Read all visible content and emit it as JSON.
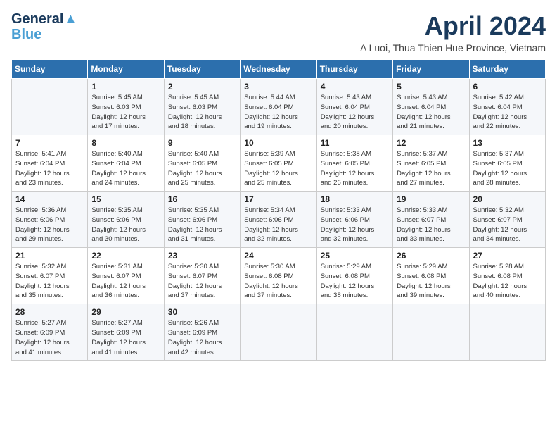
{
  "header": {
    "logo_line1": "General",
    "logo_line2": "Blue",
    "month": "April 2024",
    "location": "A Luoi, Thua Thien Hue Province, Vietnam"
  },
  "weekdays": [
    "Sunday",
    "Monday",
    "Tuesday",
    "Wednesday",
    "Thursday",
    "Friday",
    "Saturday"
  ],
  "weeks": [
    [
      {
        "day": "",
        "info": ""
      },
      {
        "day": "1",
        "info": "Sunrise: 5:45 AM\nSunset: 6:03 PM\nDaylight: 12 hours\nand 17 minutes."
      },
      {
        "day": "2",
        "info": "Sunrise: 5:45 AM\nSunset: 6:03 PM\nDaylight: 12 hours\nand 18 minutes."
      },
      {
        "day": "3",
        "info": "Sunrise: 5:44 AM\nSunset: 6:04 PM\nDaylight: 12 hours\nand 19 minutes."
      },
      {
        "day": "4",
        "info": "Sunrise: 5:43 AM\nSunset: 6:04 PM\nDaylight: 12 hours\nand 20 minutes."
      },
      {
        "day": "5",
        "info": "Sunrise: 5:43 AM\nSunset: 6:04 PM\nDaylight: 12 hours\nand 21 minutes."
      },
      {
        "day": "6",
        "info": "Sunrise: 5:42 AM\nSunset: 6:04 PM\nDaylight: 12 hours\nand 22 minutes."
      }
    ],
    [
      {
        "day": "7",
        "info": "Sunrise: 5:41 AM\nSunset: 6:04 PM\nDaylight: 12 hours\nand 23 minutes."
      },
      {
        "day": "8",
        "info": "Sunrise: 5:40 AM\nSunset: 6:04 PM\nDaylight: 12 hours\nand 24 minutes."
      },
      {
        "day": "9",
        "info": "Sunrise: 5:40 AM\nSunset: 6:05 PM\nDaylight: 12 hours\nand 25 minutes."
      },
      {
        "day": "10",
        "info": "Sunrise: 5:39 AM\nSunset: 6:05 PM\nDaylight: 12 hours\nand 25 minutes."
      },
      {
        "day": "11",
        "info": "Sunrise: 5:38 AM\nSunset: 6:05 PM\nDaylight: 12 hours\nand 26 minutes."
      },
      {
        "day": "12",
        "info": "Sunrise: 5:37 AM\nSunset: 6:05 PM\nDaylight: 12 hours\nand 27 minutes."
      },
      {
        "day": "13",
        "info": "Sunrise: 5:37 AM\nSunset: 6:05 PM\nDaylight: 12 hours\nand 28 minutes."
      }
    ],
    [
      {
        "day": "14",
        "info": "Sunrise: 5:36 AM\nSunset: 6:06 PM\nDaylight: 12 hours\nand 29 minutes."
      },
      {
        "day": "15",
        "info": "Sunrise: 5:35 AM\nSunset: 6:06 PM\nDaylight: 12 hours\nand 30 minutes."
      },
      {
        "day": "16",
        "info": "Sunrise: 5:35 AM\nSunset: 6:06 PM\nDaylight: 12 hours\nand 31 minutes."
      },
      {
        "day": "17",
        "info": "Sunrise: 5:34 AM\nSunset: 6:06 PM\nDaylight: 12 hours\nand 32 minutes."
      },
      {
        "day": "18",
        "info": "Sunrise: 5:33 AM\nSunset: 6:06 PM\nDaylight: 12 hours\nand 32 minutes."
      },
      {
        "day": "19",
        "info": "Sunrise: 5:33 AM\nSunset: 6:07 PM\nDaylight: 12 hours\nand 33 minutes."
      },
      {
        "day": "20",
        "info": "Sunrise: 5:32 AM\nSunset: 6:07 PM\nDaylight: 12 hours\nand 34 minutes."
      }
    ],
    [
      {
        "day": "21",
        "info": "Sunrise: 5:32 AM\nSunset: 6:07 PM\nDaylight: 12 hours\nand 35 minutes."
      },
      {
        "day": "22",
        "info": "Sunrise: 5:31 AM\nSunset: 6:07 PM\nDaylight: 12 hours\nand 36 minutes."
      },
      {
        "day": "23",
        "info": "Sunrise: 5:30 AM\nSunset: 6:07 PM\nDaylight: 12 hours\nand 37 minutes."
      },
      {
        "day": "24",
        "info": "Sunrise: 5:30 AM\nSunset: 6:08 PM\nDaylight: 12 hours\nand 37 minutes."
      },
      {
        "day": "25",
        "info": "Sunrise: 5:29 AM\nSunset: 6:08 PM\nDaylight: 12 hours\nand 38 minutes."
      },
      {
        "day": "26",
        "info": "Sunrise: 5:29 AM\nSunset: 6:08 PM\nDaylight: 12 hours\nand 39 minutes."
      },
      {
        "day": "27",
        "info": "Sunrise: 5:28 AM\nSunset: 6:08 PM\nDaylight: 12 hours\nand 40 minutes."
      }
    ],
    [
      {
        "day": "28",
        "info": "Sunrise: 5:27 AM\nSunset: 6:09 PM\nDaylight: 12 hours\nand 41 minutes."
      },
      {
        "day": "29",
        "info": "Sunrise: 5:27 AM\nSunset: 6:09 PM\nDaylight: 12 hours\nand 41 minutes."
      },
      {
        "day": "30",
        "info": "Sunrise: 5:26 AM\nSunset: 6:09 PM\nDaylight: 12 hours\nand 42 minutes."
      },
      {
        "day": "",
        "info": ""
      },
      {
        "day": "",
        "info": ""
      },
      {
        "day": "",
        "info": ""
      },
      {
        "day": "",
        "info": ""
      }
    ]
  ]
}
